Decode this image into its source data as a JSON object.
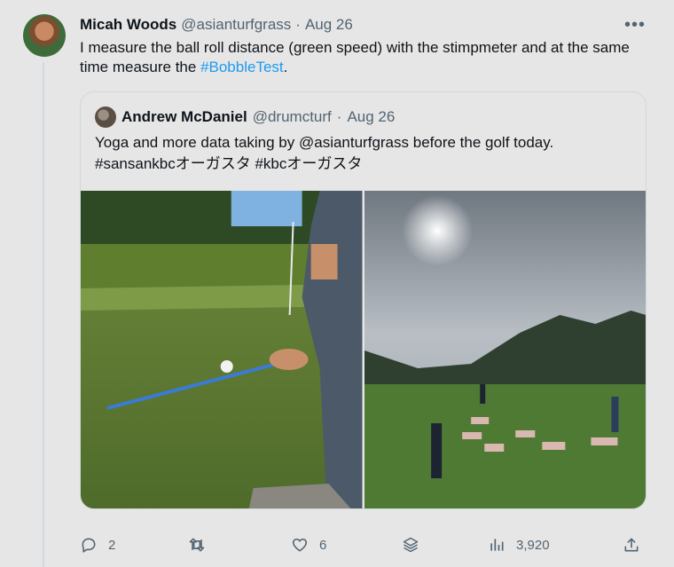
{
  "tweet": {
    "name": "Micah Woods",
    "handle": "@asianturfgrass",
    "separator": "·",
    "date": "Aug 26",
    "more": "•••",
    "text_before": "I measure the ball roll distance (green speed) with the stimpmeter and at the same time measure the ",
    "hashtag": "#BobbleTest",
    "text_after": "."
  },
  "quote": {
    "name": "Andrew McDaniel",
    "handle": "@drumcturf",
    "separator": "·",
    "date": "Aug 26",
    "line1": "Yoga and more data taking by @asianturfgrass before the golf today.",
    "line2": "#sansankbcオーガスタ #kbcオーガスタ"
  },
  "actions": {
    "replies": "2",
    "retweets": "",
    "likes": "6",
    "views": "3,920"
  },
  "icons": {
    "reply": "reply-icon",
    "retweet": "retweet-icon",
    "like": "heart-icon",
    "bookmark": "stack-icon",
    "views": "bar-chart-icon",
    "share": "share-icon"
  },
  "colors": {
    "link": "#1d9bf0",
    "muted": "#536471",
    "text": "#0f1419"
  }
}
